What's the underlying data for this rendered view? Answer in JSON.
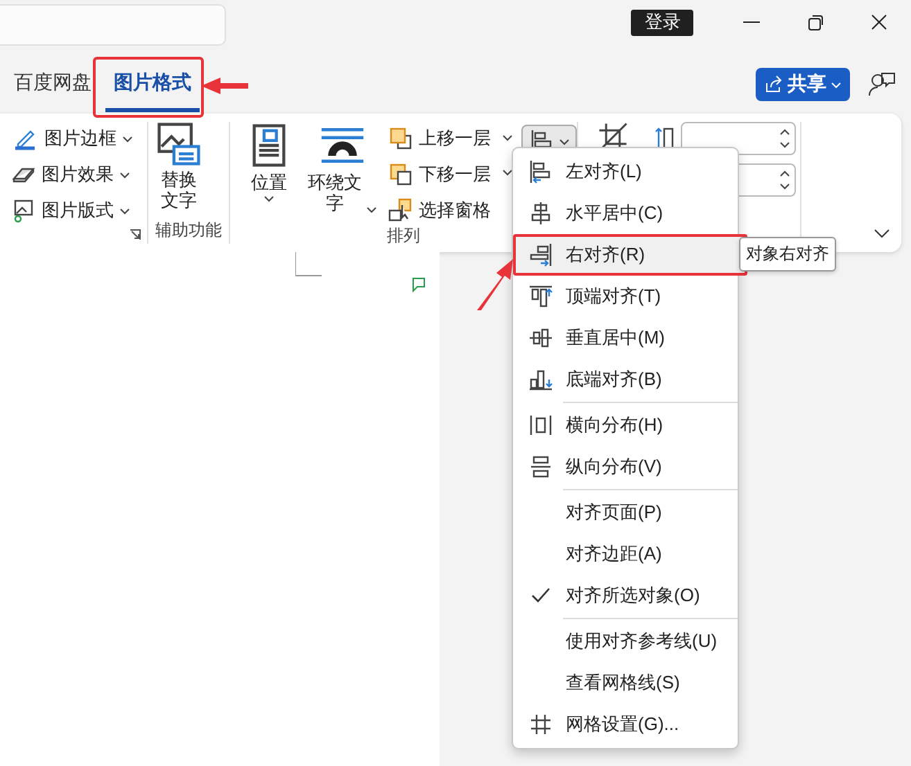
{
  "title_bar": {
    "login": "登录"
  },
  "tabs": [
    {
      "label": "百度网盘",
      "selected": false
    },
    {
      "label": "图片格式",
      "selected": true
    }
  ],
  "share": {
    "label": "共享"
  },
  "ribbon": {
    "picture_styles": {
      "items": [
        "图片边框",
        "图片效果",
        "图片版式"
      ]
    },
    "accessibility": {
      "button": "替换文字",
      "label": "辅助功能"
    },
    "arrange": {
      "position": "位置",
      "wrap": "环绕文字",
      "stack": [
        "上移一层",
        "下移一层",
        "选择窗格"
      ],
      "label": "排列"
    }
  },
  "align_menu": {
    "groups": [
      [
        {
          "label": "左对齐(L)",
          "highlighted": false,
          "checked": false
        },
        {
          "label": "水平居中(C)",
          "highlighted": false,
          "checked": false
        },
        {
          "label": "右对齐(R)",
          "highlighted": true,
          "checked": false
        },
        {
          "label": "顶端对齐(T)",
          "highlighted": false,
          "checked": false
        },
        {
          "label": "垂直居中(M)",
          "highlighted": false,
          "checked": false
        },
        {
          "label": "底端对齐(B)",
          "highlighted": false,
          "checked": false
        }
      ],
      [
        {
          "label": "横向分布(H)",
          "highlighted": false,
          "checked": false
        },
        {
          "label": "纵向分布(V)",
          "highlighted": false,
          "checked": false
        }
      ],
      [
        {
          "label": "对齐页面(P)",
          "highlighted": false,
          "checked": false
        },
        {
          "label": "对齐边距(A)",
          "highlighted": false,
          "checked": false
        },
        {
          "label": "对齐所选对象(O)",
          "highlighted": false,
          "checked": true
        }
      ],
      [
        {
          "label": "使用对齐参考线(U)",
          "highlighted": false,
          "checked": false
        },
        {
          "label": "查看网格线(S)",
          "highlighted": false,
          "checked": false
        },
        {
          "label": "网格设置(G)...",
          "highlighted": false,
          "checked": false
        }
      ]
    ]
  },
  "tooltip": "对象右对齐"
}
